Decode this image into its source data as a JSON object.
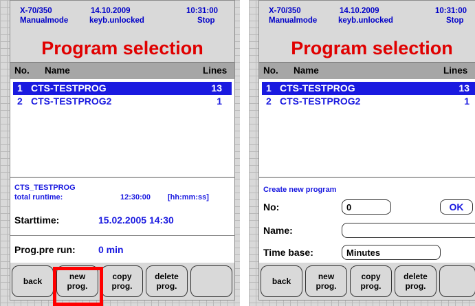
{
  "left": {
    "header": {
      "machine": "X-70/350",
      "date": "14.10.2009",
      "time": "10:31:00",
      "mode": "Manualmode",
      "keyboard": "keyb.unlocked",
      "status": "Stop"
    },
    "title": "Program selection",
    "columns": {
      "no": "No.",
      "name": "Name",
      "lines": "Lines"
    },
    "programs": [
      {
        "no": "1",
        "name": "CTS-TESTPROG",
        "lines": "13",
        "selected": true
      },
      {
        "no": "2",
        "name": "CTS-TESTPROG2",
        "lines": "1",
        "selected": false
      }
    ],
    "info": {
      "program": "CTS_TESTPROG",
      "runtime_label": "total runtime:",
      "runtime_value": "12:30:00",
      "runtime_unit": "[hh:mm:ss]"
    },
    "starttime": {
      "label": "Starttime:",
      "value": "15.02.2005  14:30"
    },
    "prerun": {
      "label": "Prog.pre run:",
      "value": "0 min"
    },
    "buttons": {
      "back": "back",
      "new": "new\nprog.",
      "copy": "copy\nprog.",
      "delete": "delete\nprog.",
      "blank": ""
    }
  },
  "right": {
    "header": {
      "machine": "X-70/350",
      "date": "14.10.2009",
      "time": "10:31:00",
      "mode": "Manualmode",
      "keyboard": "keyb.unlocked",
      "status": "Stop"
    },
    "title": "Program selection",
    "columns": {
      "no": "No.",
      "name": "Name",
      "lines": "Lines"
    },
    "programs": [
      {
        "no": "1",
        "name": "CTS-TESTPROG",
        "lines": "13",
        "selected": true
      },
      {
        "no": "2",
        "name": "CTS-TESTPROG2",
        "lines": "1",
        "selected": false
      }
    ],
    "create": {
      "heading": "Create new program",
      "no_label": "No:",
      "no_value": "0",
      "ok": "OK",
      "name_label": "Name:",
      "name_value": "",
      "timebase_label": "Time base:",
      "timebase_value": "Minutes"
    },
    "buttons": {
      "back": "back",
      "new": "new\nprog.",
      "copy": "copy\nprog.",
      "delete": "delete\nprog.",
      "blank": ""
    }
  },
  "colors": {
    "accent_blue": "#1a1ae0",
    "title_red": "#e00000",
    "highlight": "#ff0000"
  }
}
